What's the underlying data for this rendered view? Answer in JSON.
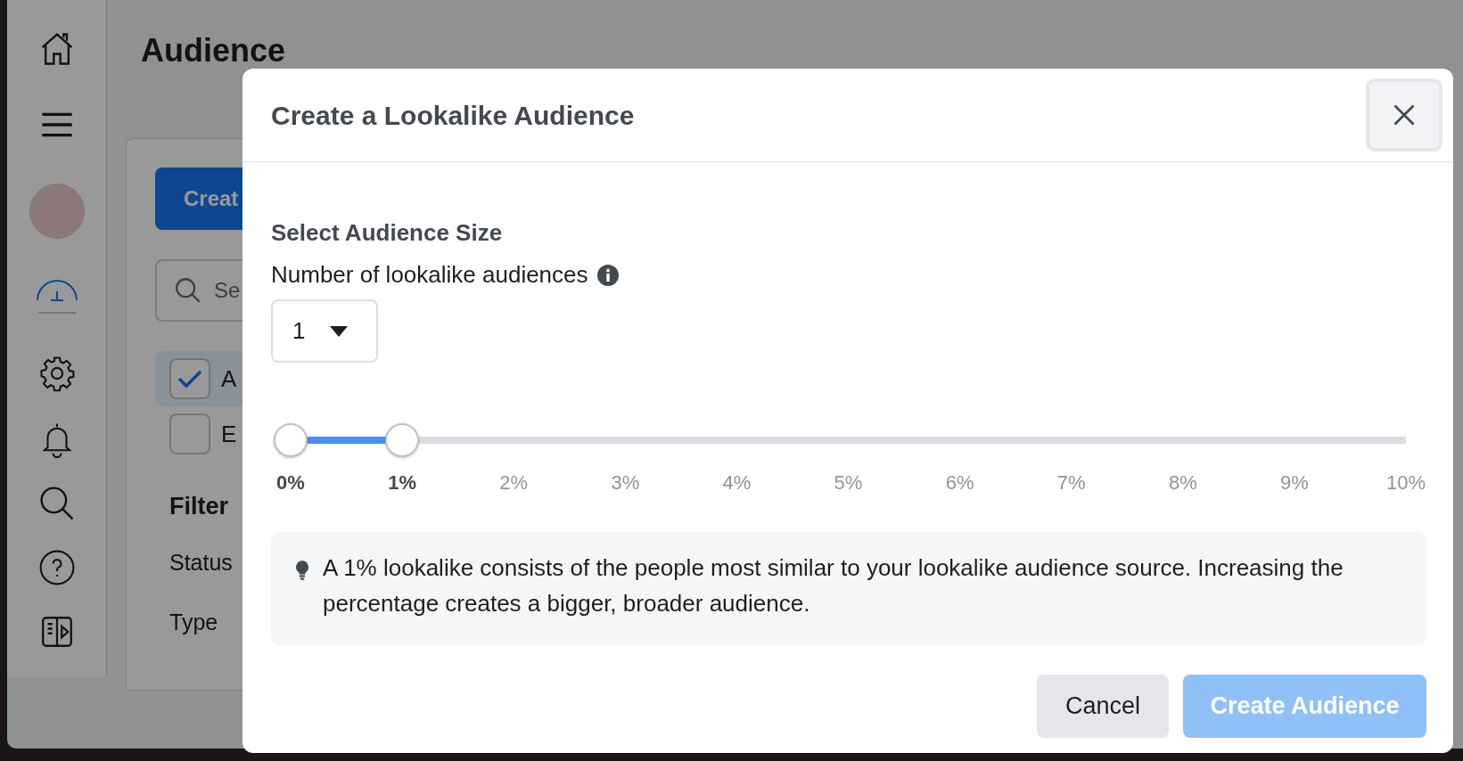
{
  "sidebar": {
    "items": [
      {
        "kind": "home",
        "selected": false
      },
      {
        "kind": "menu",
        "selected": false
      },
      {
        "kind": "avatar",
        "selected": false
      },
      {
        "kind": "gauge",
        "selected": true
      },
      {
        "kind": "gear",
        "selected": false
      },
      {
        "kind": "bell",
        "selected": false
      },
      {
        "kind": "search",
        "selected": false
      },
      {
        "kind": "help",
        "selected": false
      },
      {
        "kind": "panel",
        "selected": false
      }
    ]
  },
  "page": {
    "title": "Audience",
    "create_button": "Creat",
    "search": {
      "placeholder": "Se"
    },
    "options": [
      {
        "label": "A",
        "checked": true
      },
      {
        "label": "E",
        "checked": false
      }
    ],
    "filter_heading": "Filter",
    "filters": [
      "Status",
      "Type"
    ]
  },
  "dialog": {
    "title": "Create a Lookalike Audience",
    "section_title": "Select Audience Size",
    "count_label": "Number of lookalike audiences",
    "count_value": "1",
    "slider": {
      "thumbs": [
        {
          "level": 0
        },
        {
          "level": 0.1
        }
      ],
      "ticks": [
        {
          "label": "0%",
          "selected": true
        },
        {
          "label": "1%",
          "selected": true
        },
        {
          "label": "2%",
          "selected": false
        },
        {
          "label": "3%",
          "selected": false
        },
        {
          "label": "4%",
          "selected": false
        },
        {
          "label": "5%",
          "selected": false
        },
        {
          "label": "6%",
          "selected": false
        },
        {
          "label": "7%",
          "selected": false
        },
        {
          "label": "8%",
          "selected": false
        },
        {
          "label": "9%",
          "selected": false
        },
        {
          "label": "10%",
          "selected": false
        }
      ]
    },
    "tip": "A 1% lookalike consists of the people most similar to your lookalike audience source. Increasing the percentage creates a bigger, broader audience.",
    "buttons": [
      {
        "label": "Cancel",
        "kind": "secondary",
        "disabled": false
      },
      {
        "label": "Create Audience",
        "kind": "primary",
        "disabled": true
      }
    ]
  }
}
